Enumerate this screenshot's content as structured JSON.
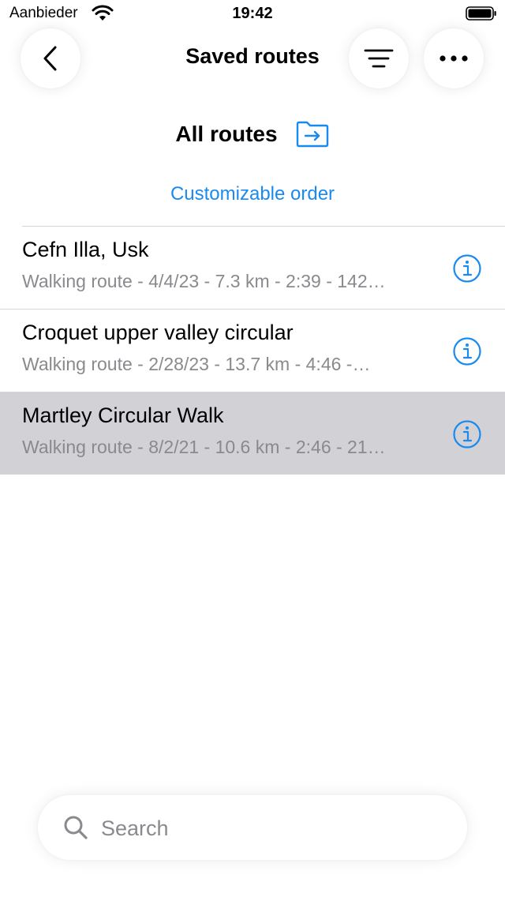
{
  "status_bar": {
    "carrier": "Aanbieder",
    "time": "19:42",
    "battery_level": 1.0
  },
  "header": {
    "title": "Saved routes",
    "back_icon": "chevron-left-icon",
    "sort_icon": "sort-lines-icon",
    "more_icon": "ellipsis-icon"
  },
  "folder": {
    "title": "All routes",
    "icon": "folder-arrow-icon"
  },
  "order_link": "Customizable order",
  "colors": {
    "accent": "#1a8aee",
    "secondary_text": "#8a8a8e",
    "selected_row": "#d2d2d6"
  },
  "routes": [
    {
      "title": "Cefn Illa, Usk",
      "subtitle": "Walking route - 4/4/23 - 7.3 km - 2:39 - 142…",
      "selected": false
    },
    {
      "title": "Croquet upper valley circular",
      "subtitle": "Walking route - 2/28/23 - 13.7 km - 4:46 -…",
      "selected": false
    },
    {
      "title": "Martley Circular Walk",
      "subtitle": "Walking route - 8/2/21 - 10.6 km - 2:46 - 21…",
      "selected": true
    }
  ],
  "search": {
    "placeholder": "Search",
    "value": ""
  }
}
